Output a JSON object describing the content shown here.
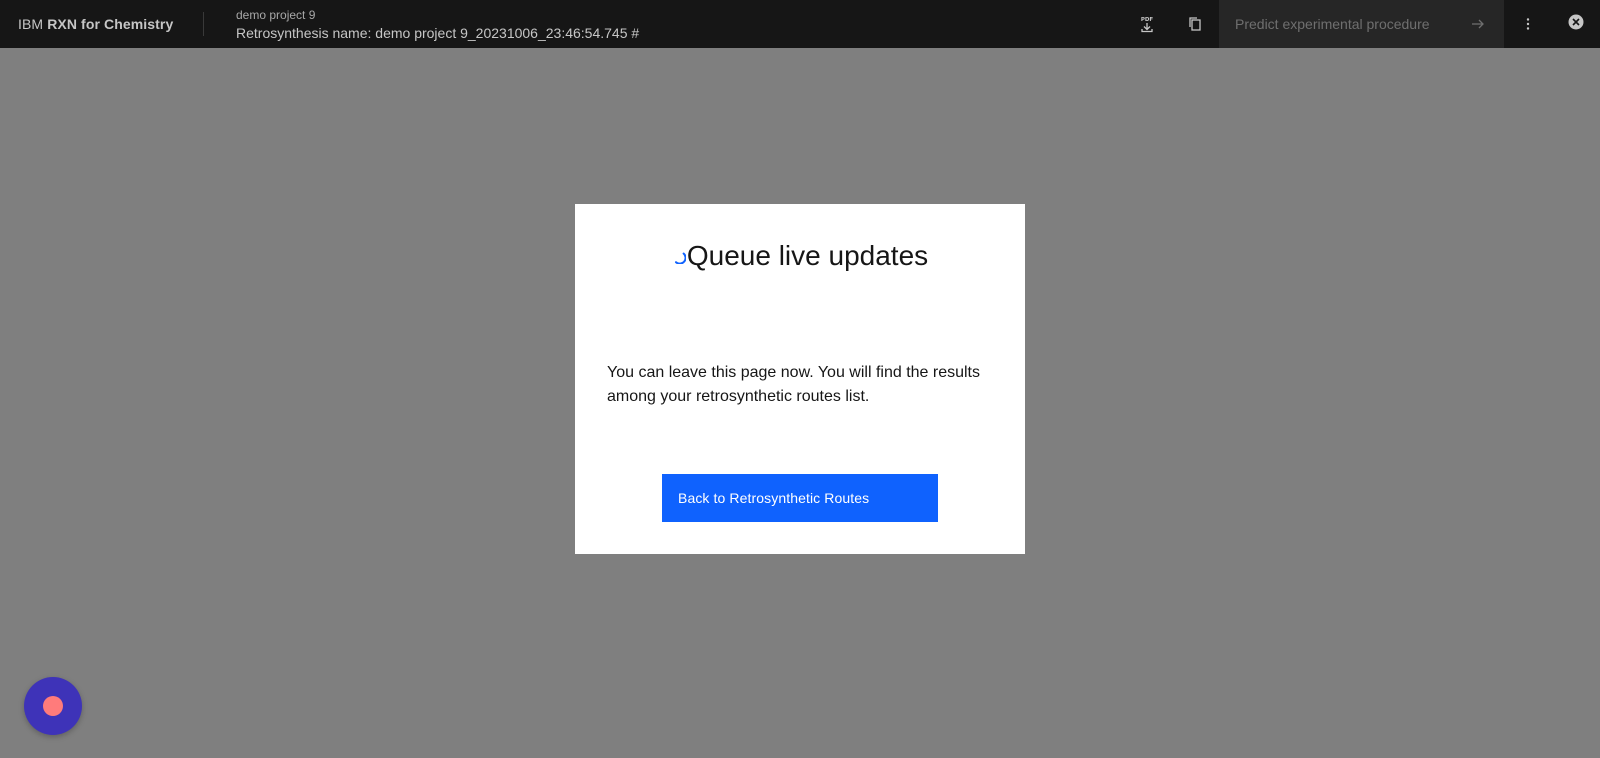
{
  "header": {
    "brand_prefix": "IBM",
    "brand_name": "RXN for Chemistry",
    "project_name": "demo project 9",
    "retrosynthesis_name": "Retrosynthesis name: demo project 9_20231006_23:46:54.745 #",
    "predict_button_label": "Predict experimental procedure",
    "icons": [
      "pdf-download-icon",
      "copy-icon",
      "arrow-right-icon",
      "overflow-menu-icon",
      "close-icon"
    ]
  },
  "modal": {
    "title": "Queue live updates",
    "message": "You can leave this page now. You will find the results among your retrosynthetic routes list.",
    "primary_button_label": "Back to Retrosynthetic Routes"
  },
  "colors": {
    "header_bg": "#161616",
    "overlay": "#7f7f7f",
    "primary": "#0f62fe",
    "chat_bg": "#3e33b8",
    "chat_dot": "#ff7b7b"
  }
}
